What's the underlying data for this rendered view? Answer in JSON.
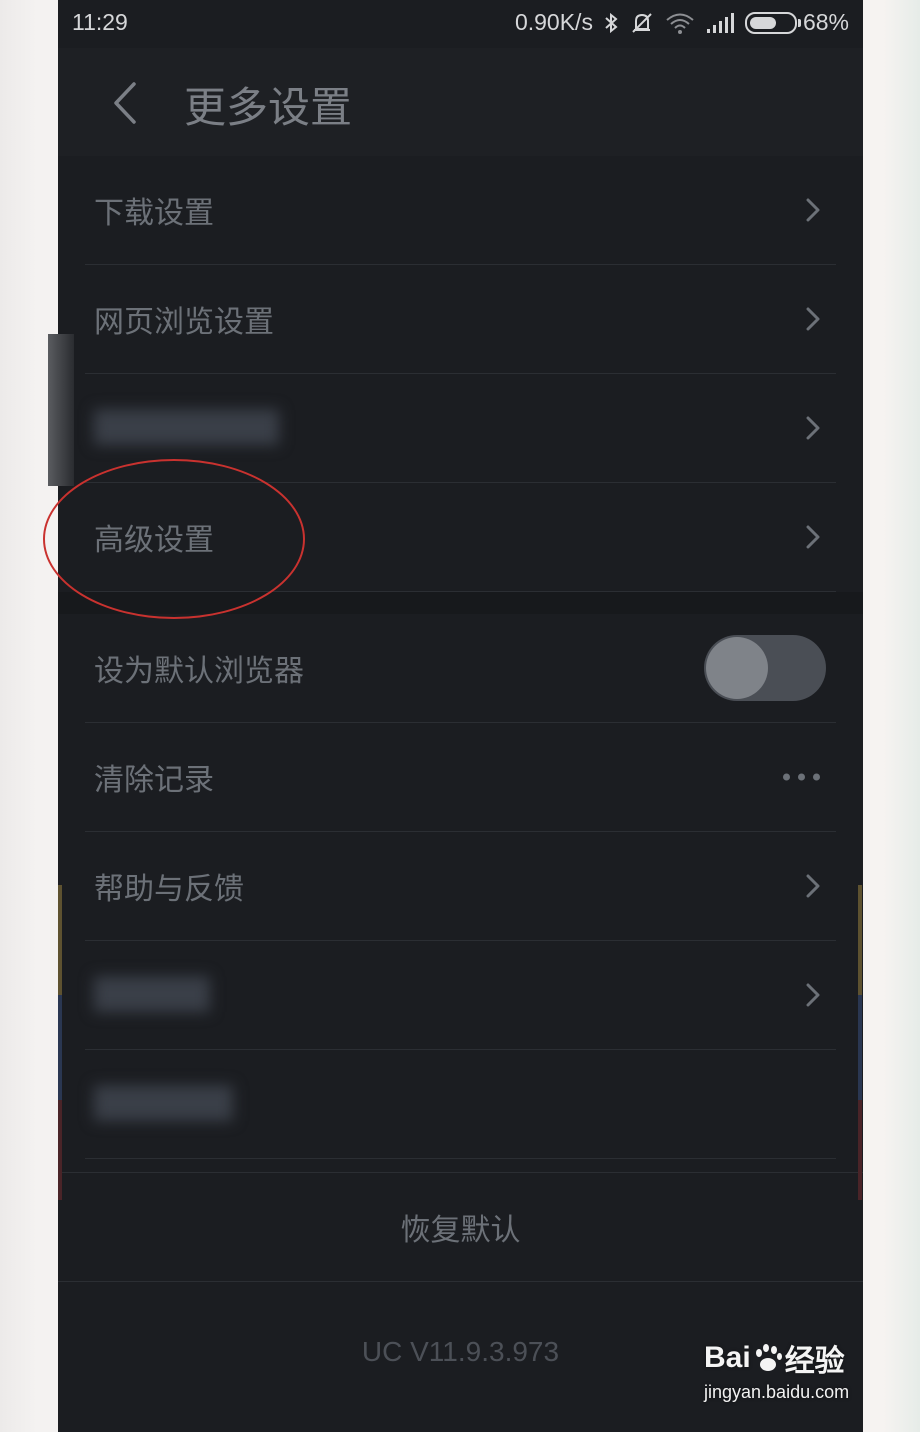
{
  "status_bar": {
    "time": "11:29",
    "network_speed": "0.90K/s",
    "battery": "68%",
    "battery_level": 0.68,
    "icons": [
      "bluetooth-icon",
      "mute-icon",
      "wifi-icon",
      "signal-icon",
      "battery-icon"
    ]
  },
  "header": {
    "title": "更多设置",
    "back_icon": "chevron-left-icon"
  },
  "settings": {
    "download": "下载设置",
    "web_browsing": "网页浏览设置",
    "blurred_item_1": "",
    "advanced": "高级设置",
    "default_browser": "设为默认浏览器",
    "default_browser_enabled": false,
    "clear_records": "清除记录",
    "help_feedback": "帮助与反馈",
    "blurred_item_2": "",
    "blurred_item_3": ""
  },
  "footer": {
    "restore_default": "恢复默认",
    "version": "UC V11.9.3.973"
  },
  "watermark": {
    "brand": "Bai",
    "brand_suffix": "经验",
    "url": "jingyan.baidu.com"
  },
  "colors": {
    "background": "#1b1d21",
    "text": "#6c7178",
    "annotation": "#c9322f"
  }
}
